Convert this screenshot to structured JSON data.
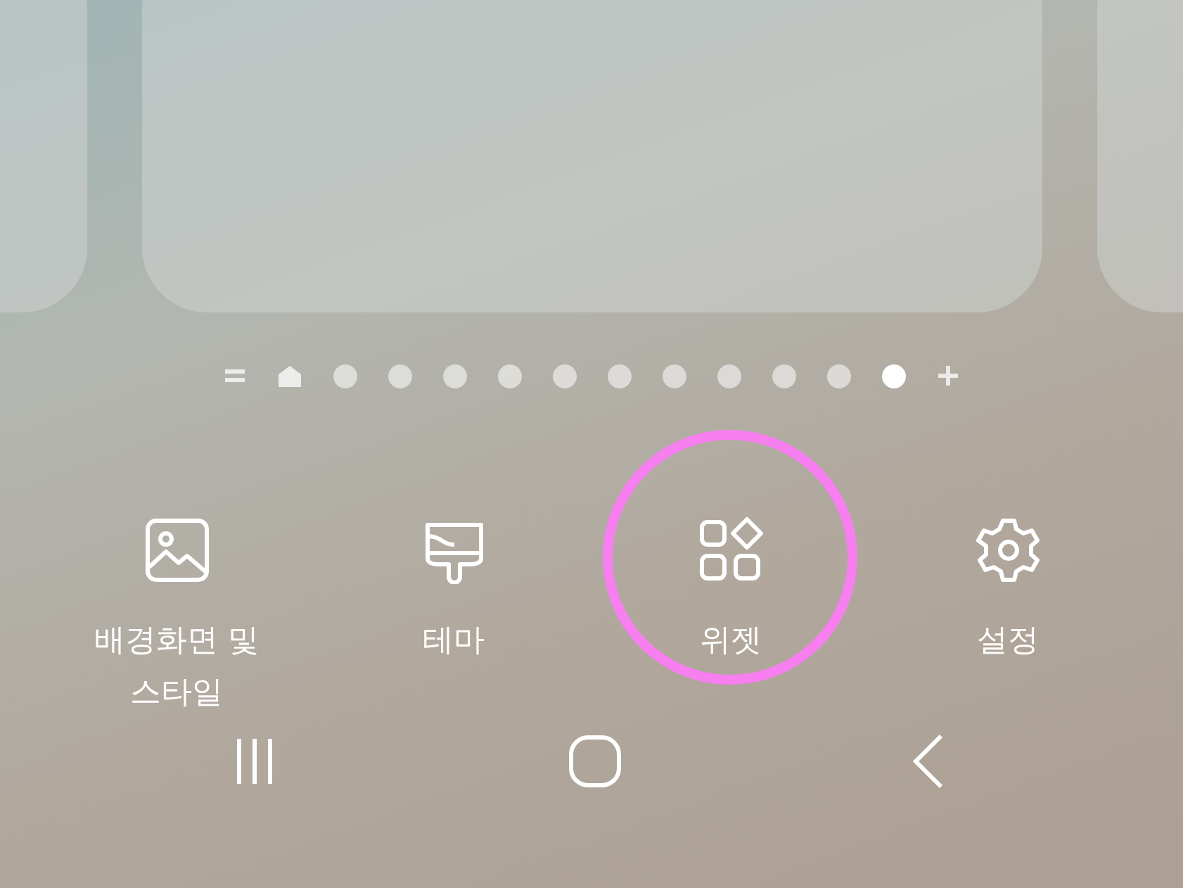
{
  "page_indicator": {
    "dots": [
      {
        "selected": false
      },
      {
        "selected": false
      },
      {
        "selected": false
      },
      {
        "selected": false
      },
      {
        "selected": false
      },
      {
        "selected": false
      },
      {
        "selected": false
      },
      {
        "selected": false
      },
      {
        "selected": false
      },
      {
        "selected": false
      },
      {
        "selected": true
      }
    ]
  },
  "options": [
    {
      "kind": "wallpaper",
      "label": "배경화면 및 스타일",
      "highlighted": false
    },
    {
      "kind": "theme",
      "label": "테마",
      "highlighted": false
    },
    {
      "kind": "widget",
      "label": "위젯",
      "highlighted": true
    },
    {
      "kind": "settings",
      "label": "설정",
      "highlighted": false
    }
  ]
}
